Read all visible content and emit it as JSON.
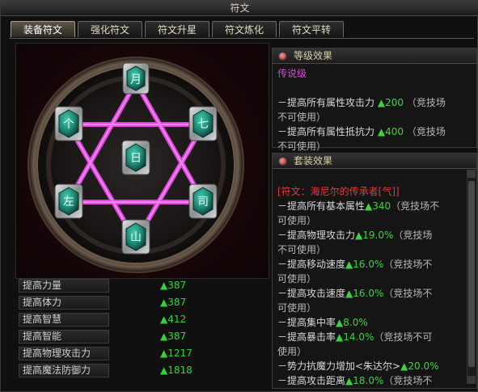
{
  "window": {
    "title": "符文"
  },
  "tabs": [
    {
      "label": "装备符文",
      "active": true
    },
    {
      "label": "强化符文",
      "active": false
    },
    {
      "label": "符文升星",
      "active": false
    },
    {
      "label": "符文炼化",
      "active": false
    },
    {
      "label": "符文平转",
      "active": false
    }
  ],
  "rune_slots": {
    "top": "月",
    "upper_left": "个",
    "upper_right": "七",
    "center": "日",
    "lower_left": "左",
    "lower_right": "司",
    "bottom": "山"
  },
  "stats": [
    {
      "label": "提高力量",
      "value": "▲387"
    },
    {
      "label": "提高体力",
      "value": "▲387"
    },
    {
      "label": "提高智慧",
      "value": "▲412"
    },
    {
      "label": "提高智能",
      "value": "▲387"
    },
    {
      "label": "提高物理攻击力",
      "value": "▲1217"
    },
    {
      "label": "提高魔法防御力",
      "value": "▲1818"
    }
  ],
  "level_effect": {
    "header": "等级效果",
    "tier": "传说级",
    "lines": [
      {
        "label": "－提高所有属性攻击力",
        "value": "▲200",
        "suffix": "（竞技场"
      },
      {
        "label": "不可使用）",
        "value": "",
        "suffix": ""
      },
      {
        "label": "－提高所有属性抵抗力",
        "value": "▲400",
        "suffix": "（竞技场"
      },
      {
        "label": "不可使用）",
        "value": "",
        "suffix": ""
      }
    ]
  },
  "set_effect": {
    "header": "套装效果",
    "set_name": "[符文：海尼尔的传承者[气]]",
    "lines": [
      {
        "label": "－提高所有基本属性",
        "value": "▲340",
        "suffix": "（竞技场不"
      },
      {
        "label": "可使用）",
        "value": "",
        "suffix": ""
      },
      {
        "label": "－提高物理攻击力",
        "value": "▲19.0%",
        "suffix": "（竞技场"
      },
      {
        "label": "不可使用）",
        "value": "",
        "suffix": ""
      },
      {
        "label": "－提高移动速度",
        "value": "▲16.0%",
        "suffix": "（竞技场不"
      },
      {
        "label": "可使用）",
        "value": "",
        "suffix": ""
      },
      {
        "label": "－提高攻击速度",
        "value": "▲16.0%",
        "suffix": "（竞技场不"
      },
      {
        "label": "可使用）",
        "value": "",
        "suffix": ""
      },
      {
        "label": "－提高集中率",
        "value": "▲8.0%",
        "suffix": ""
      },
      {
        "label": "－提高暴击率",
        "value": "▲14.0%",
        "suffix": "（竞技场不可"
      },
      {
        "label": "使用）",
        "value": "",
        "suffix": ""
      },
      {
        "label": "－势力抗魔力增加<朱达尔>",
        "value": "▲20.0%",
        "suffix": ""
      },
      {
        "label": "－提高攻击距离",
        "value": "▲18.0%",
        "suffix": "（竞技场不"
      }
    ]
  },
  "colors": {
    "accent_green": "#3fd13f",
    "tier_pink": "#e040e0",
    "set_red": "#e23b3b",
    "hexagram_magenta": "#e84be8",
    "rune_teal": "#1f8c78"
  }
}
